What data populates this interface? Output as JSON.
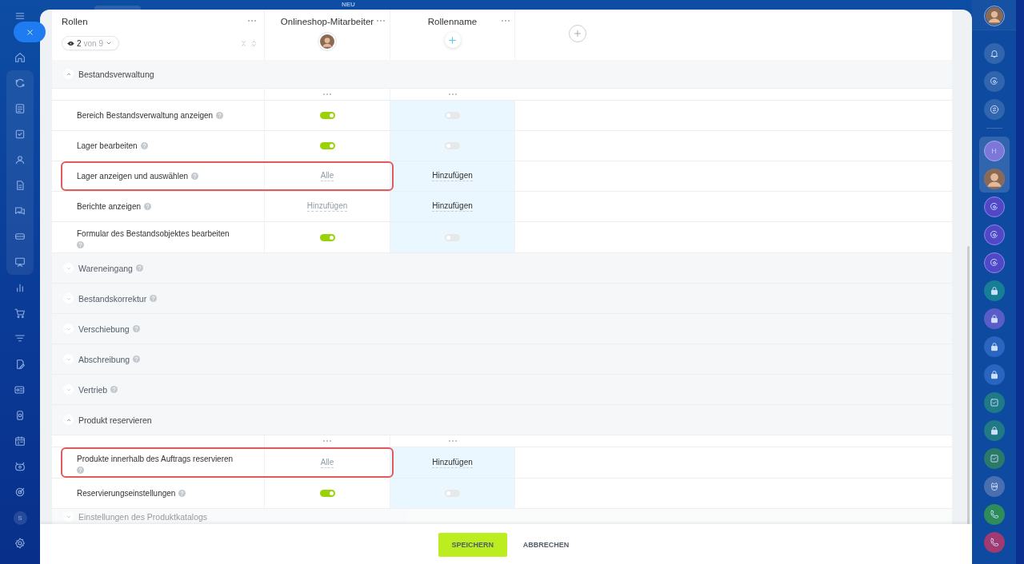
{
  "top_bar": {
    "badge": "NEU"
  },
  "left_nav": {
    "user_initial": "S"
  },
  "right_bar": {
    "chat_initial": "H"
  },
  "table": {
    "title": "Rollen",
    "filter": {
      "count": "2",
      "of": "von 9"
    },
    "columns": [
      {
        "name": "Onlineshop-Mitarbeiter",
        "kind": "avatar",
        "highlighted": false
      },
      {
        "name": "Rollenname",
        "kind": "add",
        "highlighted": true
      }
    ],
    "sections": [
      {
        "title": "Bestandsverwaltung",
        "expanded": true,
        "rows": [
          {
            "label": "Bereich Bestandsverwaltung anzeigen",
            "highlighted": false,
            "cells": [
              {
                "kind": "toggle",
                "on": true
              },
              {
                "kind": "toggle",
                "on": false
              }
            ]
          },
          {
            "label": "Lager bearbeiten",
            "highlighted": false,
            "cells": [
              {
                "kind": "toggle",
                "on": true
              },
              {
                "kind": "toggle",
                "on": false
              }
            ]
          },
          {
            "label": "Lager anzeigen und auswählen",
            "highlighted": true,
            "cells": [
              {
                "kind": "link",
                "text": "Alle"
              },
              {
                "kind": "link",
                "text": "Hinzufügen"
              }
            ]
          },
          {
            "label": "Berichte anzeigen",
            "highlighted": false,
            "cells": [
              {
                "kind": "link",
                "text": "Hinzufügen"
              },
              {
                "kind": "link",
                "text": "Hinzufügen"
              }
            ]
          },
          {
            "label": "Formular des Bestandsobjektes bearbeiten",
            "highlighted": false,
            "cells": [
              {
                "kind": "toggle",
                "on": true
              },
              {
                "kind": "toggle",
                "on": false
              }
            ]
          }
        ]
      },
      {
        "title": "Wareneingang",
        "expanded": false
      },
      {
        "title": "Bestandskorrektur",
        "expanded": false
      },
      {
        "title": "Verschiebung",
        "expanded": false
      },
      {
        "title": "Abschreibung",
        "expanded": false
      },
      {
        "title": "Vertrieb",
        "expanded": false
      },
      {
        "title": "Produkt reservieren",
        "expanded": true,
        "rows": [
          {
            "label": "Produkte innerhalb des Auftrags reservieren",
            "highlighted": true,
            "cells": [
              {
                "kind": "link",
                "text": "Alle"
              },
              {
                "kind": "link",
                "text": "Hinzufügen"
              }
            ]
          },
          {
            "label": "Reservierungseinstellungen",
            "highlighted": false,
            "cells": [
              {
                "kind": "toggle",
                "on": true
              },
              {
                "kind": "toggle",
                "on": false
              }
            ]
          }
        ]
      },
      {
        "title": "Einstellungen des Produktkatalogs",
        "expanded": false
      }
    ]
  },
  "footer": {
    "buttons": [
      {
        "label": "SPEICHERN",
        "primary": true
      },
      {
        "label": "ABBRECHEN",
        "primary": false
      }
    ]
  }
}
